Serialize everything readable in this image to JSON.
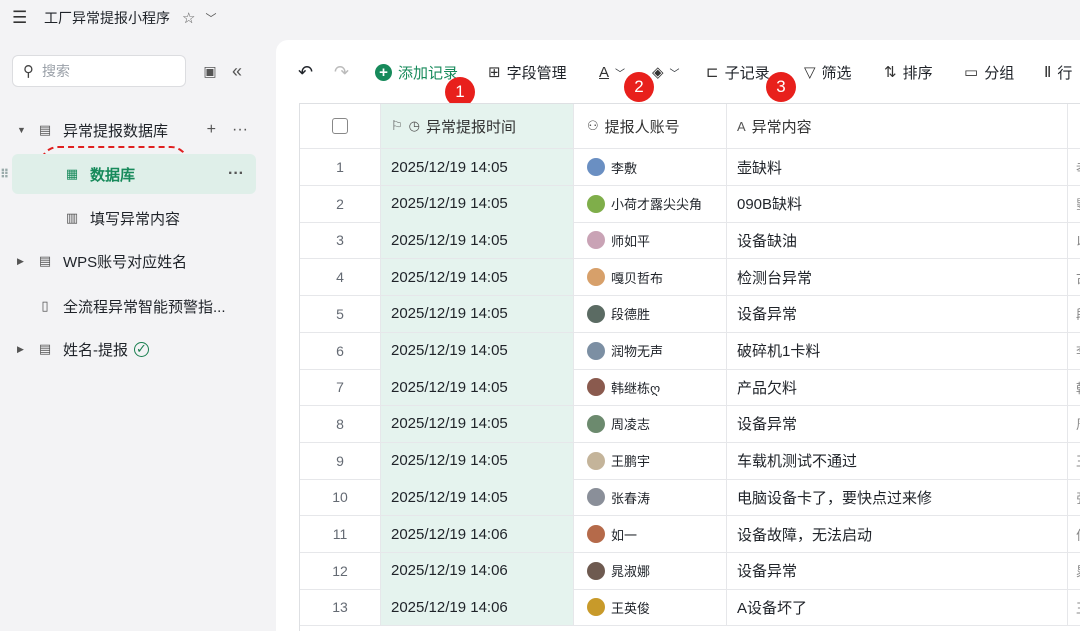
{
  "app": {
    "title": "工厂异常提报小程序"
  },
  "sidebar": {
    "search_placeholder": "搜索",
    "items": [
      {
        "label": "异常提报数据库",
        "level": 0
      },
      {
        "label": "数据库",
        "level": 1,
        "active": true
      },
      {
        "label": "填写异常内容",
        "level": 1
      },
      {
        "label": "WPS账号对应姓名",
        "level": 0
      },
      {
        "label": "全流程异常智能预警指...",
        "level": 0
      },
      {
        "label": "姓名-提报",
        "level": 0
      }
    ]
  },
  "toolbar": {
    "add_record": "添加记录",
    "field_manage": "字段管理",
    "sub_record": "子记录",
    "filter": "筛选",
    "sort": "排序",
    "group": "分组",
    "row": "行",
    "badges": [
      "1",
      "2",
      "3"
    ]
  },
  "table": {
    "headers": [
      "异常提报时间",
      "提报人账号",
      "异常内容"
    ],
    "rows": [
      {
        "idx": "1",
        "time": "2025/12/19 14:05",
        "user": "李敷",
        "content": "壶缺料",
        "extra": "孝",
        "avatar": "#6a8fc2"
      },
      {
        "idx": "2",
        "time": "2025/12/19 14:05",
        "user": "小荷才露尖尖角",
        "content": "090B缺料",
        "extra": "曌",
        "avatar": "#7fae4a"
      },
      {
        "idx": "3",
        "time": "2025/12/19 14:05",
        "user": "师如平",
        "content": "设备缺油",
        "extra": "以",
        "avatar": "#c9a3b5"
      },
      {
        "idx": "4",
        "time": "2025/12/19 14:05",
        "user": "嘎贝哲布",
        "content": "检测台异常",
        "extra": "古",
        "avatar": "#d7a06a"
      },
      {
        "idx": "5",
        "time": "2025/12/19 14:05",
        "user": "段德胜",
        "content": "设备异常",
        "extra": "段",
        "avatar": "#5b6b63"
      },
      {
        "idx": "6",
        "time": "2025/12/19 14:05",
        "user": "润物无声",
        "content": "破碎机1卡料",
        "extra": "李",
        "avatar": "#7c8fa3"
      },
      {
        "idx": "7",
        "time": "2025/12/19 14:05",
        "user": "韩继栋ღ",
        "content": "产品欠料",
        "extra": "韩",
        "avatar": "#8a5a4e"
      },
      {
        "idx": "8",
        "time": "2025/12/19 14:05",
        "user": "周凌志",
        "content": "设备异常",
        "extra": "周",
        "avatar": "#6c8a6e"
      },
      {
        "idx": "9",
        "time": "2025/12/19 14:05",
        "user": "王鹏宇",
        "content": "车载机测试不通过",
        "extra": "王",
        "avatar": "#c4b49a"
      },
      {
        "idx": "10",
        "time": "2025/12/19 14:05",
        "user": "张春涛",
        "content": "电脑设备卡了，要快点过来修",
        "extra": "张",
        "avatar": "#8a8f99"
      },
      {
        "idx": "11",
        "time": "2025/12/19 14:06",
        "user": "如一",
        "content": "设备故障，无法启动",
        "extra": "何",
        "avatar": "#b56a4a"
      },
      {
        "idx": "12",
        "time": "2025/12/19 14:06",
        "user": "晁淑娜",
        "content": "设备异常",
        "extra": "晁",
        "avatar": "#6e5a50"
      },
      {
        "idx": "13",
        "time": "2025/12/19 14:06",
        "user": "王英俊",
        "content": "A设备坏了",
        "extra": "王",
        "avatar": "#c89a2a"
      }
    ]
  }
}
